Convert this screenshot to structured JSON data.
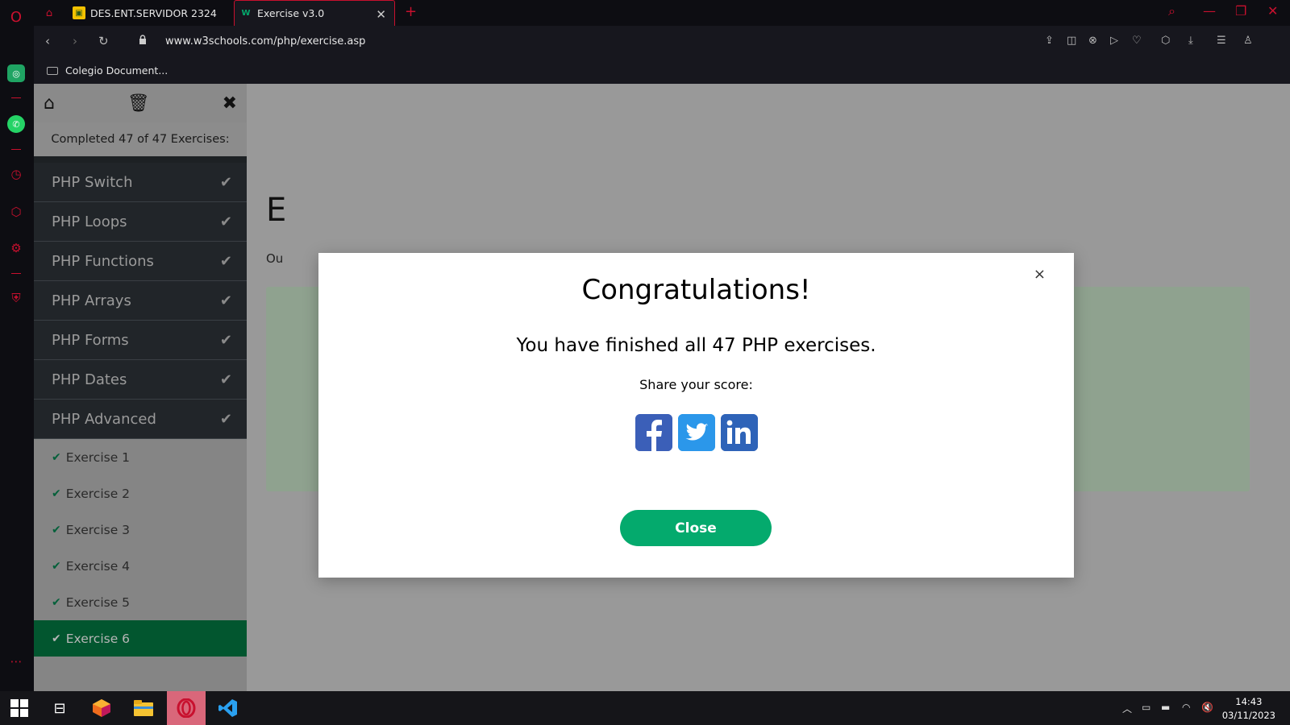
{
  "browser": {
    "tabs": [
      {
        "label": "DES.ENT.SERVIDOR 2324",
        "close": "✕"
      },
      {
        "label": "Exercise v3.0",
        "close": "✕"
      }
    ],
    "new_tab": "+",
    "url": "www.w3schools.com/php/exercise.asp",
    "bookmarks": [
      "Colegio Document..."
    ]
  },
  "sidebar": {
    "completed_text": "Completed 47 of 47 Exercises:",
    "sections": [
      {
        "label": "PHP Switch"
      },
      {
        "label": "PHP Loops"
      },
      {
        "label": "PHP Functions"
      },
      {
        "label": "PHP Arrays"
      },
      {
        "label": "PHP Forms"
      },
      {
        "label": "PHP Dates"
      },
      {
        "label": "PHP Advanced"
      }
    ],
    "exercises": [
      {
        "label": "Exercise 1"
      },
      {
        "label": "Exercise 2"
      },
      {
        "label": "Exercise 3"
      },
      {
        "label": "Exercise 4"
      },
      {
        "label": "Exercise 5"
      },
      {
        "label": "Exercise 6",
        "active": true
      }
    ]
  },
  "background": {
    "heading_partial": "E",
    "sub_partial": "Ou"
  },
  "modal": {
    "title": "Congratulations!",
    "message": "You have finished all 47 PHP exercises.",
    "share_label": "Share your score:",
    "social": [
      "facebook",
      "twitter",
      "linkedin"
    ],
    "close_x": "×",
    "close_button": "Close"
  },
  "taskbar": {
    "time": "14:43",
    "date": "03/11/2023"
  },
  "colors": {
    "accent": "#04aa6d",
    "opera_red": "#c8102e",
    "overlay_grey": "#999999"
  }
}
